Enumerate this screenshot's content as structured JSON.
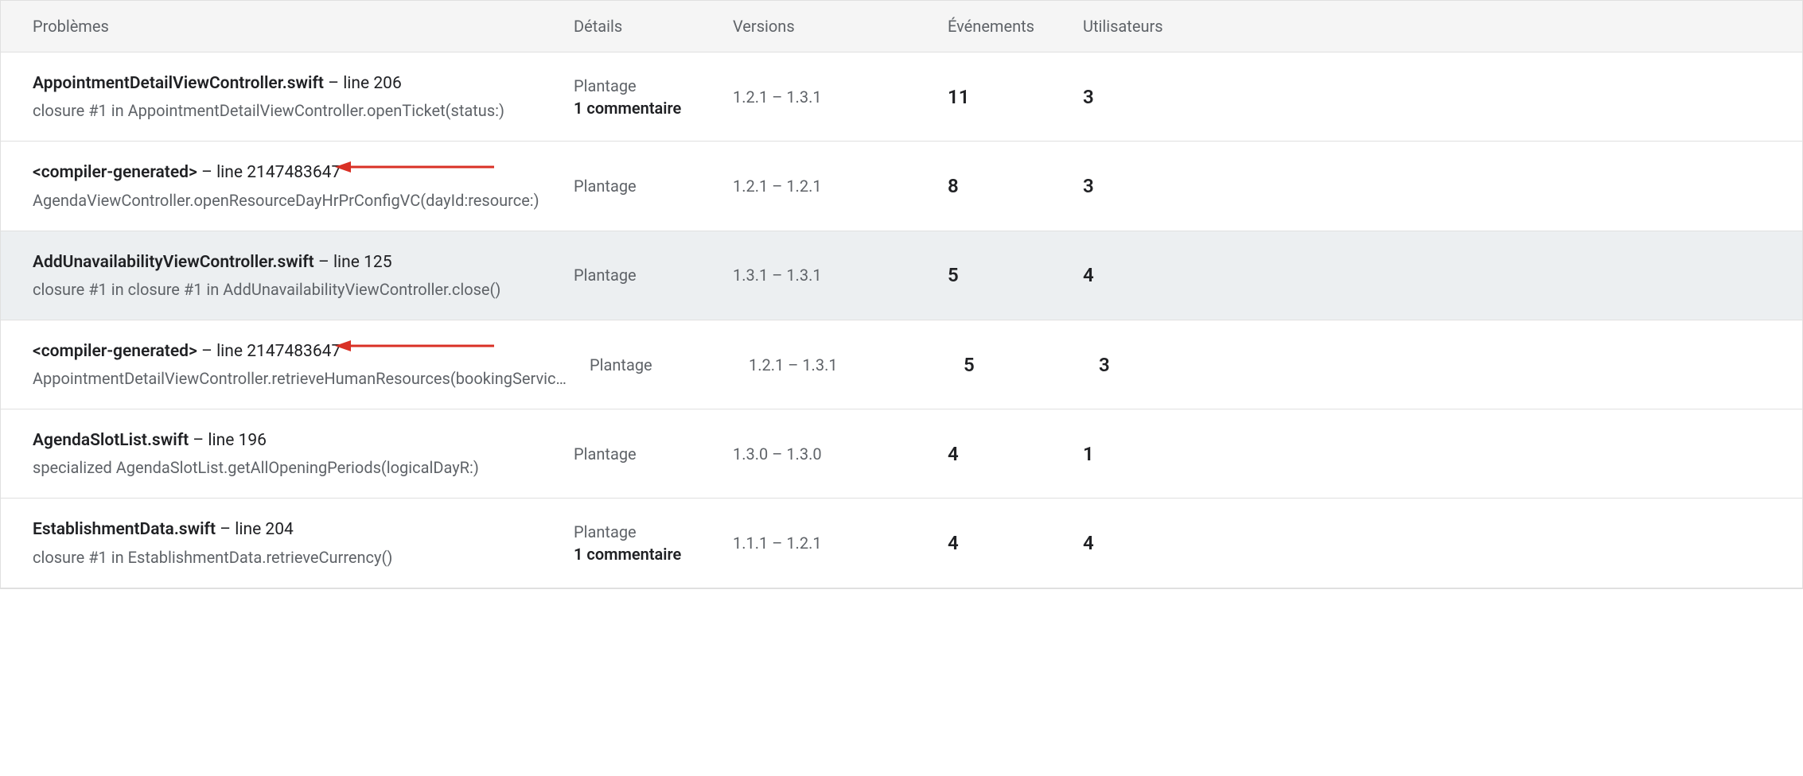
{
  "header": {
    "problems": "Problèmes",
    "details": "Détails",
    "versions": "Versions",
    "events": "Événements",
    "users": "Utilisateurs"
  },
  "rows": [
    {
      "file": "AppointmentDetailViewController.swift",
      "line_sep": " – ",
      "line": "line 206",
      "subtitle": "closure #1 in AppointmentDetailViewController.openTicket(status:)",
      "type": "Plantage",
      "comment": "1 commentaire",
      "versions": "1.2.1 – 1.3.1",
      "events": "11",
      "users": "3",
      "selected": false,
      "arrow": false
    },
    {
      "file": "<compiler-generated>",
      "line_sep": " – ",
      "line": "line 2147483647",
      "subtitle": "AgendaViewController.openResourceDayHrPrConfigVC(dayId:resource:)",
      "type": "Plantage",
      "comment": "",
      "versions": "1.2.1 – 1.2.1",
      "events": "8",
      "users": "3",
      "selected": false,
      "arrow": true
    },
    {
      "file": "AddUnavailabilityViewController.swift",
      "line_sep": " – ",
      "line": "line 125",
      "subtitle": "closure #1 in closure #1 in AddUnavailabilityViewController.close()",
      "type": "Plantage",
      "comment": "",
      "versions": "1.3.1 – 1.3.1",
      "events": "5",
      "users": "4",
      "selected": true,
      "arrow": false
    },
    {
      "file": "<compiler-generated>",
      "line_sep": " – ",
      "line": "line 2147483647",
      "subtitle": "AppointmentDetailViewController.retrieveHumanResources(bookingService:ser…",
      "type": "Plantage",
      "comment": "",
      "versions": "1.2.1 – 1.3.1",
      "events": "5",
      "users": "3",
      "selected": false,
      "arrow": true
    },
    {
      "file": "AgendaSlotList.swift",
      "line_sep": " – ",
      "line": "line 196",
      "subtitle": "specialized AgendaSlotList.getAllOpeningPeriods(logicalDayR:)",
      "type": "Plantage",
      "comment": "",
      "versions": "1.3.0 – 1.3.0",
      "events": "4",
      "users": "1",
      "selected": false,
      "arrow": false
    },
    {
      "file": "EstablishmentData.swift",
      "line_sep": " – ",
      "line": "line 204",
      "subtitle": "closure #1 in EstablishmentData.retrieveCurrency()",
      "type": "Plantage",
      "comment": "1 commentaire",
      "versions": "1.1.1 – 1.2.1",
      "events": "4",
      "users": "4",
      "selected": false,
      "arrow": false
    }
  ],
  "arrow_color": "#d93025"
}
